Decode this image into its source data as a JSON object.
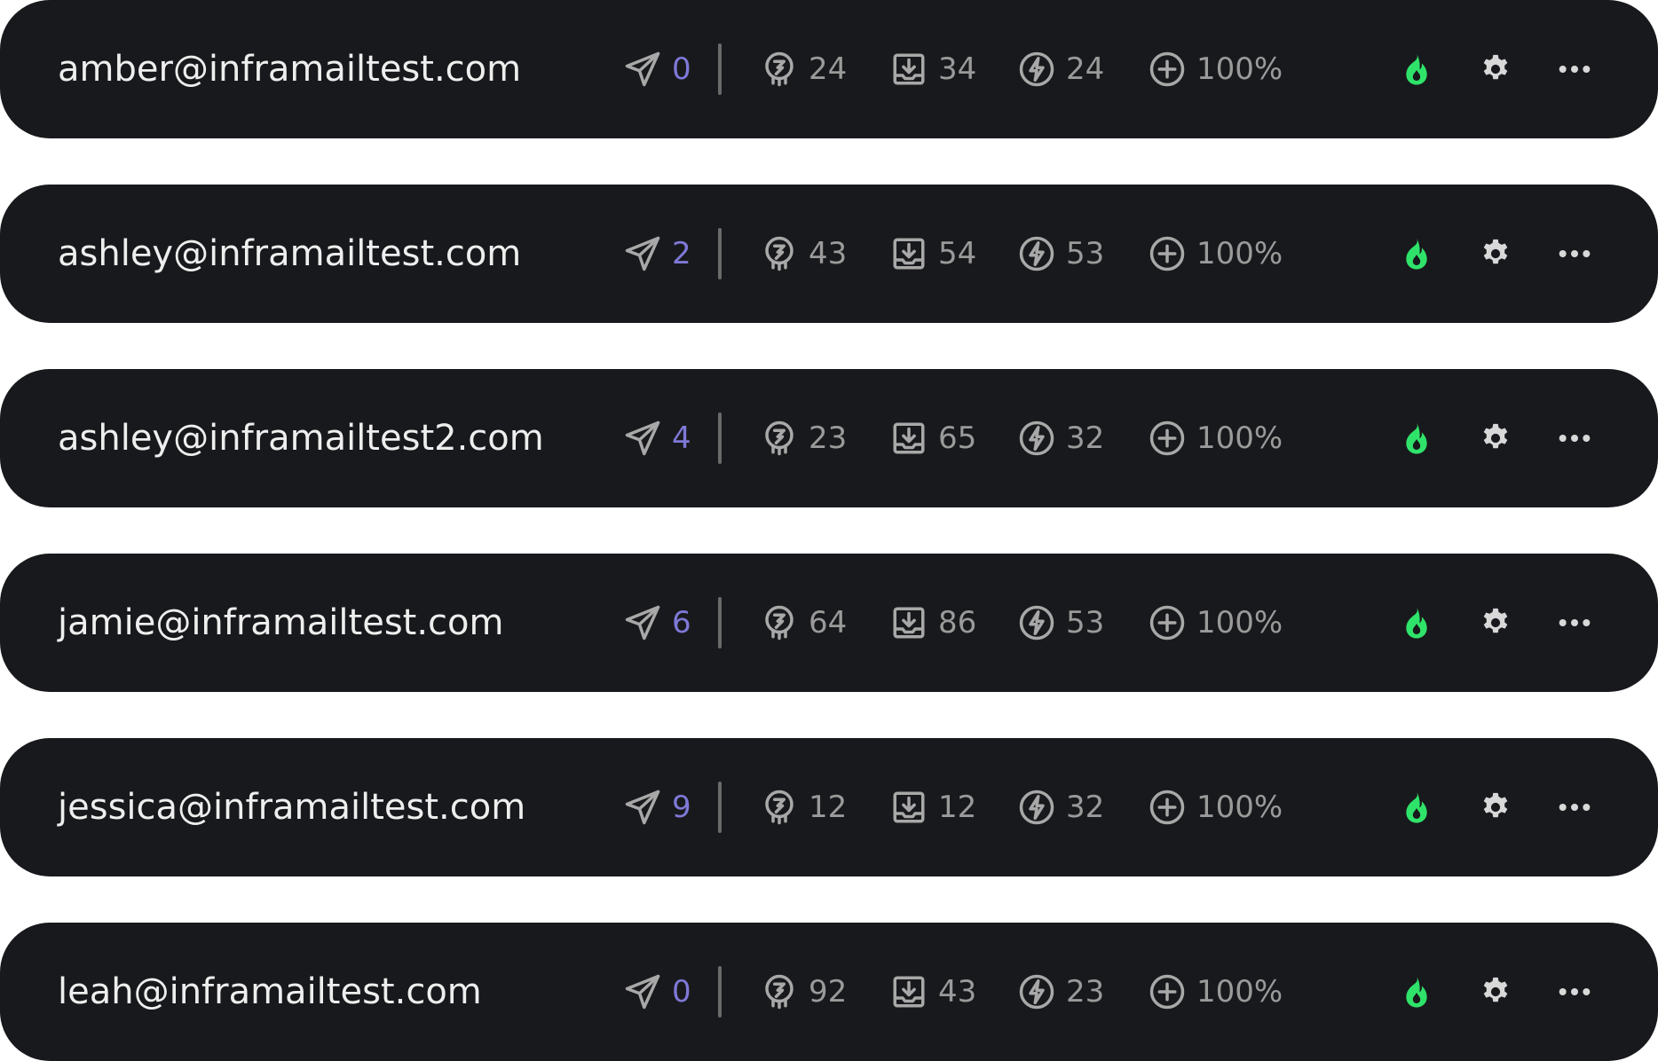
{
  "rows": [
    {
      "email": "amber@inframailtest.com",
      "sent": "0",
      "warmup": "24",
      "inbox": "34",
      "speed": "24",
      "health": "100%"
    },
    {
      "email": "ashley@inframailtest.com",
      "sent": "2",
      "warmup": "43",
      "inbox": "54",
      "speed": "53",
      "health": "100%"
    },
    {
      "email": "ashley@inframailtest2.com",
      "sent": "4",
      "warmup": "23",
      "inbox": "65",
      "speed": "32",
      "health": "100%"
    },
    {
      "email": "jamie@inframailtest.com",
      "sent": "6",
      "warmup": "64",
      "inbox": "86",
      "speed": "53",
      "health": "100%"
    },
    {
      "email": "jessica@inframailtest.com",
      "sent": "9",
      "warmup": "12",
      "inbox": "12",
      "speed": "32",
      "health": "100%"
    },
    {
      "email": "leah@inframailtest.com",
      "sent": "0",
      "warmup": "92",
      "inbox": "43",
      "speed": "23",
      "health": "100%"
    }
  ],
  "icons": {
    "sent": "paper-plane-icon",
    "warmup": "warmup-badge-icon",
    "inbox": "inbox-download-icon",
    "speed": "lightning-bolt-icon",
    "health": "plus-circle-icon",
    "flame": "flame-icon",
    "settings": "gear-icon",
    "more": "more-dots-icon"
  },
  "colors": {
    "row_background": "#18191c",
    "email_text": "#eeeeee",
    "stat_text": "#9a9a9a",
    "sent_count": "#7f79d8",
    "flame": "#2fe36a",
    "icon": "#d8d8d8"
  }
}
